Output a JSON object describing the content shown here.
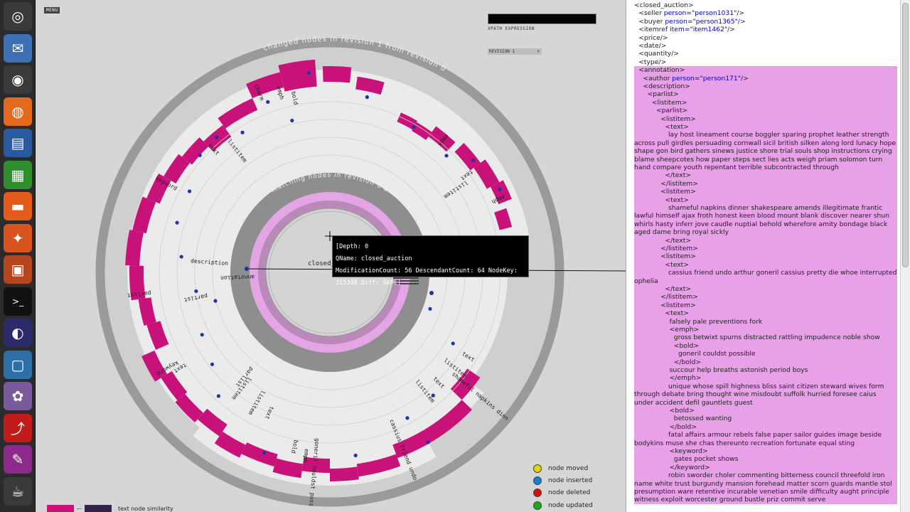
{
  "launcher": {
    "items": [
      {
        "name": "dash-home-icon",
        "glyph": "◎",
        "bg": "#3a3a3a"
      },
      {
        "name": "thunderbird-icon",
        "glyph": "✉",
        "bg": "#3d6fb5"
      },
      {
        "name": "chrome-icon",
        "glyph": "◉",
        "bg": "#3a3a3a"
      },
      {
        "name": "firefox-icon",
        "glyph": "◍",
        "bg": "#e36a1c"
      },
      {
        "name": "writer-icon",
        "glyph": "▤",
        "bg": "#2c5aa0"
      },
      {
        "name": "calc-icon",
        "glyph": "▦",
        "bg": "#2f8f2f"
      },
      {
        "name": "files-icon",
        "glyph": "▬",
        "bg": "#e55b1a"
      },
      {
        "name": "software-center-icon",
        "glyph": "✦",
        "bg": "#d9531e"
      },
      {
        "name": "impress-icon",
        "glyph": "▣",
        "bg": "#b5451c"
      },
      {
        "name": "terminal-icon",
        "glyph": ">_",
        "bg": "#111111"
      },
      {
        "name": "eclipse-icon",
        "glyph": "◐",
        "bg": "#2b2b6b"
      },
      {
        "name": "remote-desktop-icon",
        "glyph": "▢",
        "bg": "#2e6fa8"
      },
      {
        "name": "pidgin-icon",
        "glyph": "✿",
        "bg": "#7a5a9a"
      },
      {
        "name": "pdf-reader-icon",
        "glyph": "⤴",
        "bg": "#c11b1b"
      },
      {
        "name": "inkscape-icon",
        "glyph": "✎",
        "bg": "#8b2a8b"
      },
      {
        "name": "java-app-icon",
        "glyph": "☕",
        "bg": "#3a3a3a"
      }
    ]
  },
  "toolbar": {
    "menu_label": "MENU",
    "xpath_label": "XPATH EXPRESSION",
    "revision_value": "REVISION 1",
    "revision_arrow": "▾"
  },
  "viz": {
    "outer_ring_label": "changed nodes in revision 1 from revision 0",
    "inner_ring_label": "matching nodes in revision 0 and revision 1",
    "center_label": "closed_",
    "node_labels": {
      "charm": "charm",
      "emph1": "emph",
      "bold1": "bold",
      "text1": "text",
      "listitem1": "listitem",
      "keyword1": "keyword",
      "emph2": "emph",
      "text2": "text",
      "listitem2": "listitem",
      "emph3": "emph",
      "parlist": "parlist",
      "description": "description",
      "partist": "partist",
      "annotation": "annotation",
      "keyword2": "keyword",
      "text3": "text",
      "listitem3": "listitem",
      "parlist2": "parlist",
      "listitem4": "listitem",
      "text4": "text",
      "bold2": "bold",
      "emph4": "emph",
      "listitem5": "listitem",
      "text5": "text",
      "listitem6": "listitem",
      "text6": "text",
      "emph5": "emph",
      "bold3": "bold",
      "goneril": "goneril couldst poss",
      "cassius": "cassius friend undo",
      "shameful": "shameful napkins dinn"
    }
  },
  "tooltip": {
    "depth": "[Depth: 0",
    "qname": "QName: closed_auction",
    "details": "ModificationCount: 56 DescendantCount: 64 NodeKey: 315348 Diff: SAME]"
  },
  "legend": {
    "items": [
      {
        "label": "node moved",
        "color": "#e6d400"
      },
      {
        "label": "node inserted",
        "color": "#1a7fd0"
      },
      {
        "label": "node deleted",
        "color": "#d00f0f"
      },
      {
        "label": "node updated",
        "color": "#11b011"
      }
    ],
    "similarity_label": "text node similarity",
    "similarity_dash": "—"
  },
  "xml": {
    "lines": [
      {
        "indent": 0,
        "text": "<closed_auction>",
        "hl": false
      },
      {
        "indent": 1,
        "pre": "<seller ",
        "attr": "person=\"person1031\"",
        "post": "/>",
        "hl": false
      },
      {
        "indent": 1,
        "pre": "<buyer ",
        "attr": "person=\"person1365\"",
        "post": "/>",
        "hl": false
      },
      {
        "indent": 1,
        "pre": "<itemref ",
        "attr": "item=\"item1462\"",
        "post": "/>",
        "hl": false
      },
      {
        "indent": 1,
        "text": "<price/>",
        "hl": false
      },
      {
        "indent": 1,
        "text": "<date/>",
        "hl": false
      },
      {
        "indent": 1,
        "text": "<quantity/>",
        "hl": false
      },
      {
        "indent": 1,
        "text": "<type/>",
        "hl": false
      },
      {
        "indent": 1,
        "text": "<annotation>",
        "hl": true
      },
      {
        "indent": 2,
        "pre": "<author ",
        "attr": "person=\"person171\"",
        "post": "/>",
        "hl": true
      },
      {
        "indent": 2,
        "text": "<description>",
        "hl": true
      },
      {
        "indent": 3,
        "text": "<parlist>",
        "hl": true
      },
      {
        "indent": 4,
        "text": "<listitem>",
        "hl": true
      },
      {
        "indent": 5,
        "text": "<parlist>",
        "hl": true
      },
      {
        "indent": 6,
        "text": "<listitem>",
        "hl": true
      },
      {
        "indent": 7,
        "text": "<text>",
        "hl": true
      }
    ],
    "para1": "lay host lineament course boggler sparing prophet leather strength across pull girdles persuading cornwall sicil british silken along lord lunacy hope shape gon bird gathers sinews justice shore trial souls shop instructions crying blame sheepcotes how paper steps sect lies acts weigh priam solomon turn hand compare youth repentant terrible subcontracted through",
    "lines2": [
      "</text>",
      "</listitem>",
      "<listitem>",
      "<text>"
    ],
    "para2": "shameful napkins dinner shakespeare amends illegitimate frantic lawful himself ajax froth honest keen blood mount blank discover nearer shun whirls hasty inferr jove caudle nuptial behold wherefore amity bondage black aged dame bring royal sickly",
    "lines3": [
      "</text>",
      "</listitem>",
      "<listitem>",
      "<text>"
    ],
    "para3": "cassius friend undo arthur goneril cassius pretty die whoe interrupted ophelia",
    "lines4": [
      "</text>",
      "</listitem>",
      "<listitem>",
      "<text>"
    ],
    "line_falsely": "falsely pale preventions fork",
    "emph_open": "<emph>",
    "line_gross": "gross betwixt spurns distracted rattling impudence noble show",
    "bold_open": "<bold>",
    "line_goneril": "goneril couldst possible",
    "bold_close": "</bold>",
    "line_succour": "succour help breaths astonish period boys",
    "emph_close": "</emph>",
    "para_unique": "unique whose spill highness bliss saint citizen steward wives form through debate bring thought wine misdoubt suffolk hurried foresee caius under accident defil gauntlets guest",
    "bold_open2": "<bold>",
    "line_betossed": "betossed wanting",
    "bold_close2": "</bold>",
    "para_fatal": "fatal affairs armour rebels false paper sailor guides image beside bodykins muse she chas thereunto recreation fortunate equal sting",
    "keyword_open": "<keyword>",
    "line_gates": "gates pocket shows",
    "keyword_close": "</keyword>",
    "para_robin": "robin sworder choler commenting bitterness council threefold iron name white trust burgundy mansion forehead matter scorn guards mantle stol presumption ware retentive incurable venetian smile difficulty aught principle witness exploit worcester ground bustle priz commit serve"
  }
}
